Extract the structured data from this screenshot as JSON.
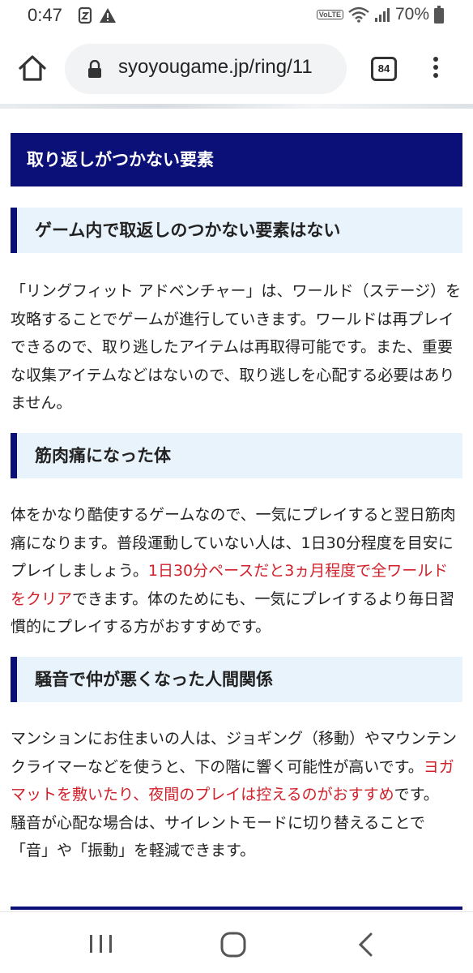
{
  "status": {
    "time": "0:47",
    "volte": "VoLTE",
    "battery": "70%"
  },
  "browser": {
    "url": "syoyougame.jp/ring/11",
    "tab_count": "84"
  },
  "article": {
    "section_title": "取り返しがつかない要素",
    "subsections": [
      {
        "heading": "ゲーム内で取返しのつかない要素はない",
        "body": "「リングフィット アドベンチャー」は、ワールド（ステージ）を攻略することでゲームが進行していきます。ワールドは再プレイできるので、取り逃したアイテムは再取得可能です。また、重要な収集アイテムなどはないので、取り逃しを心配する必要はありません。"
      },
      {
        "heading": "筋肉痛になった体",
        "body_1": "体をかなり酷使するゲームなので、一気にプレイすると翌日筋肉痛になります。普段運動していない人は、1日30分程度を目安にプレイしましょう。",
        "body_red": "1日30分ペースだと3ヵ月程度で全ワールドをクリア",
        "body_2": "できます。体のためにも、一気にプレイするより毎日習慣的にプレイする方がおすすめです。"
      },
      {
        "heading": "騒音で仲が悪くなった人間関係",
        "body_1": "マンションにお住まいの人は、ジョギング（移動）やマウンテンクライマーなどを使うと、下の階に響く可能性が高いです。",
        "body_red": "ヨガマットを敷いたり、夜間のプレイは控えるのがおすすめ",
        "body_2": "です。",
        "body_3": "騒音が心配な場合は、サイレントモードに切り替えることで「音」や「振動」を軽減できます。"
      }
    ]
  },
  "colors": {
    "heading_navy": "#0a1078",
    "subheading_bg": "#e9f3fc",
    "highlight_red": "#d0202a"
  },
  "icons": [
    "home-icon",
    "lock-icon",
    "tabs-icon",
    "more-vert-icon",
    "recent-apps-icon",
    "home-nav-icon",
    "back-icon",
    "wifi-icon",
    "signal-icon",
    "battery-icon",
    "alert-icon",
    "sync-icon"
  ]
}
